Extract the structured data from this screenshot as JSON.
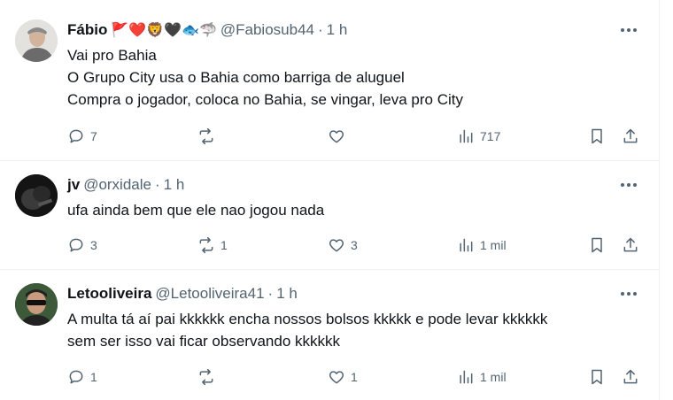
{
  "tweets": [
    {
      "name": "Fábio",
      "emojis": "🚩❤️🦁🖤🐟🦈",
      "handle": "@Fabiosub44",
      "sep": "·",
      "time": "1 h",
      "lines": [
        "Vai pro Bahia",
        "O Grupo City usa o Bahia como barriga de aluguel",
        "Compra o jogador, coloca no Bahia, se vingar, leva pro City"
      ],
      "replies": "7",
      "reposts": "",
      "likes": "",
      "views": "717"
    },
    {
      "name": "jv",
      "emojis": "",
      "handle": "@orxidale",
      "sep": "·",
      "time": "1 h",
      "lines": [
        "ufa ainda bem que ele nao jogou nada"
      ],
      "replies": "3",
      "reposts": "1",
      "likes": "3",
      "views": "1 mil"
    },
    {
      "name": "Letooliveira",
      "emojis": "",
      "handle": "@Letooliveira41",
      "sep": "·",
      "time": "1 h",
      "lines": [
        "A multa tá aí pai kkkkkk encha nossos bolsos kkkkk e pode levar kkkkkk",
        "sem ser isso vai ficar observando kkkkkk"
      ],
      "replies": "1",
      "reposts": "",
      "likes": "1",
      "views": "1 mil"
    }
  ],
  "colors": {
    "text": "#0f1419",
    "secondary": "#536471",
    "border": "#eff3f4"
  }
}
